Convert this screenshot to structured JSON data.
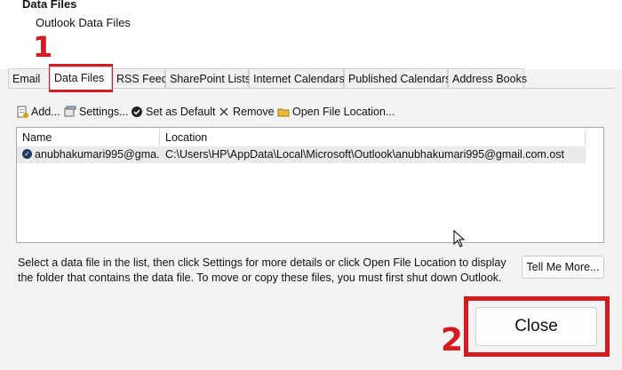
{
  "header": {
    "title": "Data Files",
    "subtitle": "Outlook Data Files"
  },
  "annotations": {
    "step1": "1",
    "step2": "2",
    "highlight_color": "#d71920"
  },
  "tabs": [
    {
      "label": "Email",
      "active": false
    },
    {
      "label": "Data Files",
      "active": true
    },
    {
      "label": "RSS Feeds",
      "active": false
    },
    {
      "label": "SharePoint Lists",
      "active": false
    },
    {
      "label": "Internet Calendars",
      "active": false
    },
    {
      "label": "Published Calendars",
      "active": false
    },
    {
      "label": "Address Books",
      "active": false
    }
  ],
  "toolbar": {
    "add": {
      "label": "Add...",
      "icon": "add-file-icon"
    },
    "settings": {
      "label": "Settings...",
      "icon": "settings-icon"
    },
    "default": {
      "label": "Set as Default",
      "icon": "check-circle-icon"
    },
    "remove": {
      "label": "Remove",
      "icon": "x-icon"
    },
    "open": {
      "label": "Open File Location...",
      "icon": "folder-icon"
    }
  },
  "table": {
    "columns": [
      "Name",
      "Location"
    ],
    "rows": [
      {
        "name": "anubhakumari995@gma...",
        "location": "C:\\Users\\HP\\AppData\\Local\\Microsoft\\Outlook\\anubhakumari995@gmail.com.ost",
        "default": true
      }
    ]
  },
  "description": "Select a data file in the list, then click Settings for more details or click Open File Location to display the folder that contains the data file. To move or copy these files, you must first shut down Outlook.",
  "buttons": {
    "tell_me_more": "Tell Me More...",
    "close": "Close"
  }
}
